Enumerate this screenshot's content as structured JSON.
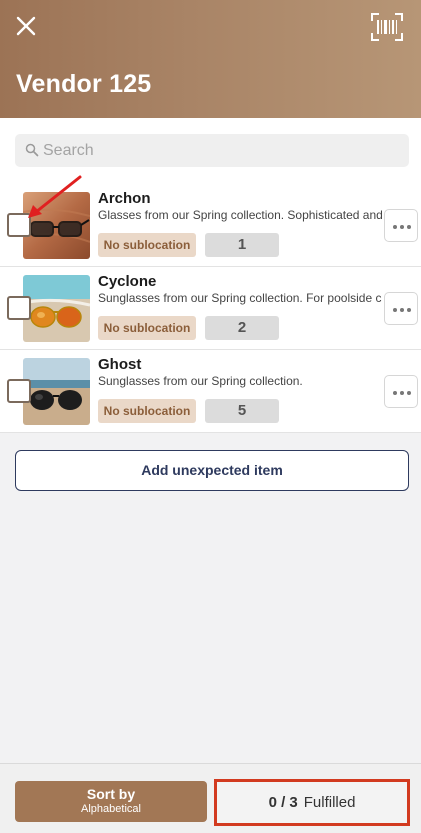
{
  "header": {
    "title": "Vendor 125",
    "close_icon": "close-icon",
    "scan_icon": "barcode-scan-icon",
    "gradient": [
      "#9c7355",
      "#b79676"
    ]
  },
  "search": {
    "placeholder": "Search",
    "value": ""
  },
  "items": [
    {
      "name": "Archon",
      "description": "Glasses from our Spring collection. Sophisticated and",
      "sublocation": "No sublocation",
      "quantity": "1",
      "checked": false,
      "image_icon": "eyeglasses-on-wood-thumbnail"
    },
    {
      "name": "Cyclone",
      "description": "Sunglasses from our Spring collection. For poolside c",
      "sublocation": "No sublocation",
      "quantity": "2",
      "checked": false,
      "image_icon": "aviator-sunglasses-on-sand-thumbnail"
    },
    {
      "name": "Ghost",
      "description": "Sunglasses from our Spring collection.",
      "sublocation": "No sublocation",
      "quantity": "5",
      "checked": false,
      "image_icon": "sunglasses-on-beach-thumbnail"
    }
  ],
  "add_unexpected_label": "Add unexpected item",
  "footer": {
    "sort_title": "Sort by",
    "sort_value": "Alphabetical",
    "fulfilled_count": "0 / 3",
    "fulfilled_label": "Fulfilled"
  },
  "colors": {
    "brand": "#a27755",
    "sublocation_bg": "#ead8c8",
    "sublocation_text": "#8b5e3a",
    "outline_button": "#2e3a5e",
    "highlight": "#d23a1f"
  }
}
